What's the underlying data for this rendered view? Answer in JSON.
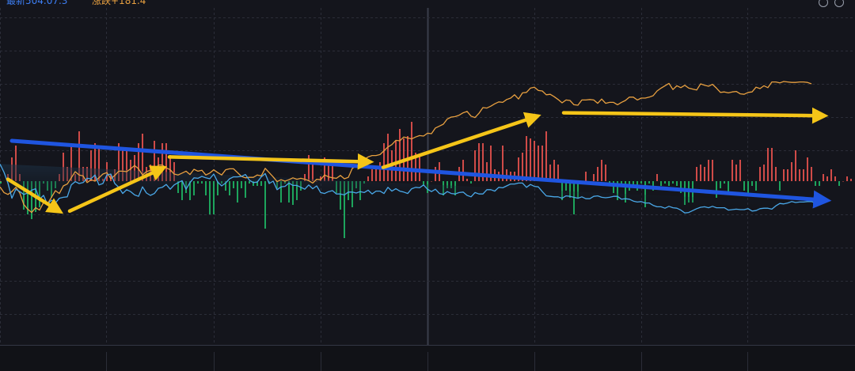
{
  "header": {
    "legend_a": "最新504.07.3",
    "legend_b": "涨跌+181.4",
    "color_a": "#3d7ff5",
    "color_b": "#e8a040",
    "tools": [
      "refresh-icon",
      "settings-icon"
    ]
  },
  "chart_data": {
    "type": "line",
    "grid": true,
    "x": [
      0,
      5,
      10,
      15,
      20,
      25,
      30,
      35,
      40,
      45,
      50,
      55,
      60,
      65,
      70,
      75,
      80,
      85,
      90,
      95,
      100,
      105,
      110,
      115,
      120,
      125,
      130,
      135,
      140,
      145,
      150,
      155,
      160,
      165,
      170,
      175,
      180,
      185,
      190,
      195,
      200,
      205,
      210,
      215,
      220,
      225,
      230,
      235,
      240,
      245,
      250,
      255,
      260,
      265,
      270,
      275,
      280,
      285,
      290,
      295,
      300,
      305,
      310,
      315,
      320,
      325,
      330,
      335,
      340,
      345,
      350,
      355,
      360,
      365,
      370,
      375,
      380,
      385,
      390,
      395,
      400,
      405,
      410,
      415,
      420,
      425,
      430,
      435,
      440,
      445,
      450,
      455,
      460,
      465,
      470,
      475,
      480,
      485,
      490,
      495,
      500,
      505,
      510,
      515,
      520,
      525,
      530,
      535,
      540,
      545,
      550,
      555,
      560,
      565,
      570,
      575,
      580,
      585,
      590,
      595,
      600,
      605,
      610,
      615,
      620,
      625,
      630,
      635,
      640,
      645,
      650,
      655,
      660,
      665,
      670,
      675,
      680,
      685,
      690,
      695,
      700,
      705,
      710,
      715,
      720,
      725,
      730,
      735,
      740,
      745,
      750,
      755,
      760,
      765,
      770,
      775,
      780,
      785,
      790,
      795,
      800,
      805,
      810,
      815,
      820,
      825,
      830,
      835,
      840,
      845,
      850,
      855,
      860,
      865,
      870,
      875,
      880,
      885,
      890,
      895,
      900,
      905,
      910,
      915,
      920,
      925,
      930,
      935,
      940,
      945,
      950,
      955,
      960,
      965,
      970,
      975,
      980,
      985,
      990,
      995,
      1000,
      1005,
      1010,
      1015,
      1020,
      1025,
      1030,
      1035,
      1040,
      1045,
      1050,
      1055,
      1060,
      1065,
      1070,
      1075
    ],
    "series": [
      {
        "color": "#e8a040",
        "values": [
          -1.2,
          -2.4,
          -2.8,
          -2.2,
          -1.3,
          -2.5,
          -4.9,
          -5.9,
          -6.6,
          -5.6,
          -6.1,
          -4.5,
          -4.8,
          -3.4,
          -2.0,
          -2.6,
          -1.0,
          -0.6,
          0.7,
          2.0,
          1.3,
          1.1,
          -0.3,
          0.3,
          -0.0,
          0.7,
          1.5,
          1.8,
          0.5,
          1.2,
          2.1,
          2.1,
          2.0,
          2.6,
          3.3,
          2.6,
          1.3,
          2.0,
          2.3,
          2.0,
          3.4,
          3.4,
          2.8,
          2.4,
          1.5,
          1.3,
          1.7,
          2.1,
          1.4,
          2.5,
          2.1,
          2.3,
          1.3,
          1.7,
          2.4,
          1.8,
          1.3,
          2.4,
          2.6,
          2.6,
          1.8,
          1.0,
          0.7,
          0.8,
          0.8,
          1.3,
          1.1,
          2.7,
          1.8,
          0.9,
          -0.1,
          0.3,
          -0.0,
          0.3,
          0.7,
          0.4,
          0.6,
          0.4,
          0.1,
          -0.4,
          0.4,
          0.3,
          1.3,
          0.9,
          0.7,
          0.6,
          1.2,
          0.5,
          0.8,
          2.7,
          3.2,
          3.4,
          4.6,
          5.1,
          5.4,
          5.4,
          5.6,
          6.4,
          7.2,
          7.7,
          8.6,
          8.5,
          9.3,
          9.1,
          8.9,
          9.3,
          9.6,
          9.5,
          10.1,
          10.0,
          11.2,
          11.6,
          12.0,
          13.1,
          13.5,
          13.6,
          13.9,
          14.4,
          14.7,
          13.7,
          13.4,
          14.3,
          15.5,
          15.4,
          15.8,
          16.3,
          16.7,
          16.6,
          17.2,
          17.5,
          18.2,
          17.3,
          18.6,
          18.7,
          19.6,
          19.8,
          19.1,
          19.0,
          18.2,
          18.3,
          17.8,
          17.2,
          16.5,
          17.1,
          17.0,
          16.1,
          16.0,
          17.1,
          17.1,
          17.2,
          17.1,
          16.4,
          17.3,
          16.4,
          16.6,
          16.6,
          16.1,
          16.6,
          17.0,
          17.7,
          17.7,
          17.1,
          17.5,
          17.5,
          17.7,
          18.0,
          19.0,
          19.6,
          20.1,
          20.6,
          19.3,
          20.1,
          19.7,
          20.2,
          19.6,
          19.4,
          19.2,
          20.5,
          20.2,
          20.0,
          20.4,
          19.6,
          18.7,
          18.8,
          18.6,
          18.8,
          18.9,
          18.4,
          18.3,
          18.7,
          18.8,
          19.8,
          19.5,
          20.1,
          19.7,
          20.9,
          20.9,
          20.7,
          21.0,
          20.9,
          20.8,
          20.8,
          20.9,
          20.9,
          20.8,
          20.5
        ]
      },
      {
        "color": "#4aa8e8",
        "values": [
          3.6,
          1.9,
          -0.4,
          -3.6,
          -1.7,
          -2.2,
          -2.8,
          -2.5,
          -1.9,
          -1.6,
          -3.8,
          -3.0,
          -4.9,
          -4.0,
          -4.6,
          -3.6,
          -3.4,
          -3.3,
          -0.8,
          -0.1,
          -0.5,
          -0.3,
          0.6,
          0.5,
          1.3,
          -0.8,
          -0.5,
          1.3,
          1.5,
          -0.5,
          -1.3,
          -2.6,
          -1.8,
          -2.2,
          -2.9,
          -3.2,
          -1.2,
          -2.5,
          -3.0,
          -2.6,
          -1.5,
          -1.3,
          -0.7,
          -1.7,
          -0.8,
          -0.3,
          0.1,
          -1.7,
          -0.3,
          0.7,
          0.6,
          1.0,
          0.7,
          0.5,
          1.5,
          -0.2,
          -1.0,
          -0.4,
          0.5,
          0.9,
          0.9,
          1.0,
          1.4,
          0.2,
          -0.3,
          -0.2,
          0.9,
          1.6,
          -0.5,
          0.0,
          -1.8,
          -1.2,
          -1.1,
          -0.4,
          -0.9,
          -0.9,
          -1.3,
          -1.7,
          -0.8,
          -1.6,
          -1.0,
          -2.4,
          -2.6,
          -2.2,
          -2.0,
          -2.7,
          -2.7,
          -2.9,
          -2.3,
          -2.3,
          -2.5,
          -2.2,
          -2.4,
          -1.9,
          -2.7,
          -2.1,
          -2.1,
          -2.6,
          -1.3,
          -2.1,
          -1.6,
          -2.1,
          -2.3,
          -2.6,
          -1.6,
          -1.3,
          -1.4,
          -0.8,
          -1.7,
          -2.2,
          -1.7,
          -2.6,
          -2.8,
          -2.2,
          -2.6,
          -2.7,
          -2.4,
          -2.3,
          -3.0,
          -3.3,
          -2.4,
          -2.7,
          -2.7,
          -1.8,
          -1.8,
          -2.1,
          -1.3,
          -1.4,
          -1.0,
          -0.6,
          -0.6,
          -0.4,
          -0.4,
          -1.3,
          -0.7,
          -1.1,
          -1.2,
          -2.2,
          -3.1,
          -3.2,
          -3.3,
          -3.3,
          -3.6,
          -3.1,
          -3.2,
          -3.4,
          -3.6,
          -3.3,
          -3.7,
          -3.7,
          -3.2,
          -3.1,
          -3.4,
          -3.5,
          -3.4,
          -3.2,
          -3.2,
          -3.8,
          -3.7,
          -3.8,
          -4.2,
          -4.4,
          -4.3,
          -4.6,
          -4.6,
          -5.1,
          -5.4,
          -5.4,
          -5.7,
          -5.3,
          -5.6,
          -5.7,
          -6.1,
          -6.7,
          -6.6,
          -6.2,
          -5.8,
          -5.5,
          -5.4,
          -5.6,
          -5.3,
          -5.6,
          -5.6,
          -5.6,
          -6.1,
          -6.0,
          -5.9,
          -6.0,
          -6.0,
          -5.8,
          -6.3,
          -6.2,
          -5.8,
          -5.7,
          -5.7,
          -5.9,
          -5.2,
          -4.7,
          -4.8,
          -4.6,
          -4.3,
          -4.5,
          -4.4,
          -4.4,
          -4.3,
          -4.3,
          -4.6
        ]
      }
    ],
    "histogram": {
      "x": [
        10,
        15,
        20,
        25,
        30,
        35,
        40,
        45,
        50,
        55,
        60,
        65,
        70,
        75,
        80,
        85,
        90,
        95,
        100,
        105,
        110,
        115,
        120,
        125,
        130,
        135,
        140,
        145,
        150,
        155,
        160,
        165,
        170,
        175,
        180,
        185,
        190,
        195,
        200,
        205,
        210,
        215,
        220,
        225,
        230,
        235,
        240,
        245,
        250,
        255,
        260,
        265,
        270,
        275,
        280,
        285,
        290,
        295,
        300,
        305,
        310,
        315,
        320,
        325,
        330,
        335,
        340,
        345,
        350,
        355,
        360,
        365,
        370,
        375,
        380,
        385,
        390,
        395,
        400,
        405,
        410,
        415,
        420,
        425,
        430,
        435,
        440,
        445,
        450,
        455,
        460,
        465,
        470,
        475,
        480,
        485,
        490,
        495,
        500,
        505,
        510,
        515,
        520,
        525,
        530,
        535,
        540,
        545,
        550,
        555,
        560,
        565,
        570,
        575,
        580,
        585,
        590,
        595,
        600,
        605,
        610,
        615,
        620,
        625,
        630,
        635,
        640,
        645,
        650,
        655,
        660,
        665,
        670,
        675,
        680,
        685,
        690,
        695,
        700,
        705,
        710,
        715,
        720,
        725,
        730,
        735,
        740,
        745,
        750,
        755,
        760,
        765,
        770,
        775,
        780,
        785,
        790,
        795,
        800,
        805,
        810,
        815,
        820,
        825,
        830,
        835,
        840,
        845,
        850,
        855,
        860,
        865,
        870,
        875,
        880,
        885,
        890,
        895,
        900,
        905,
        910,
        915,
        920,
        925,
        930,
        935,
        940,
        945,
        950,
        955,
        960,
        965,
        970,
        975,
        980,
        985,
        990,
        995,
        1000,
        1005,
        1010,
        1015,
        1020,
        1025,
        1030,
        1035,
        1040,
        1045,
        1050,
        1055,
        1060,
        1065,
        1070,
        1075
      ],
      "values": [
        0.3,
        1.0,
        1.5,
        0.3,
        -1.2,
        -1.4,
        -1.6,
        -1.3,
        -1.1,
        -0.1,
        -0.4,
        -0.7,
        -0.3,
        0.3,
        1.2,
        0.6,
        1.6,
        0.3,
        2.1,
        0.6,
        0.6,
        1.3,
        1.6,
        1.4,
        0.1,
        0.8,
        0.3,
        0.5,
        1.6,
        1.3,
        1.3,
        0.9,
        1.1,
        1.6,
        2.0,
        0.6,
        0.7,
        1.7,
        1.0,
        1.6,
        1.6,
        1.1,
        0.8,
        -0.5,
        -0.8,
        -0.5,
        -0.8,
        -0.6,
        -0.1,
        -0.1,
        -0.6,
        -1.4,
        -1.4,
        -0.6,
        -0.1,
        -0.4,
        -0.6,
        -0.3,
        -0.9,
        -0.3,
        -0.7,
        -0.1,
        -0.2,
        -0.2,
        -0.2,
        -2.0,
        -0.1,
        -0.0,
        -0.3,
        -0.9,
        -0.1,
        -0.9,
        -1.0,
        -0.8,
        -0.4,
        0.3,
        1.1,
        0.7,
        0.0,
        0.2,
        1.0,
        0.7,
        0.7,
        -0.5,
        -1.2,
        -2.4,
        -0.8,
        -1.1,
        -0.3,
        -0.8,
        -0.1,
        0.2,
        0.5,
        0.6,
        0.8,
        1.6,
        2.0,
        1.3,
        1.7,
        2.2,
        1.8,
        1.9,
        2.5,
        1.2,
        1.1,
        -0.2,
        -0.5,
        -0.0,
        0.6,
        0.8,
        -0.6,
        -0.3,
        -0.3,
        -0.6,
        0.6,
        0.9,
        0.1,
        -0.1,
        1.3,
        1.6,
        1.6,
        0.8,
        1.5,
        0.5,
        0.4,
        1.5,
        0.5,
        0.4,
        0.4,
        1.0,
        1.2,
        1.9,
        1.8,
        1.7,
        1.5,
        1.5,
        2.1,
        0.7,
        0.9,
        0.7,
        -0.8,
        -0.4,
        -0.7,
        -1.4,
        -0.7,
        -0.0,
        0.4,
        -0.1,
        0.3,
        0.6,
        0.9,
        0.7,
        -0.2,
        -0.5,
        -0.8,
        -0.2,
        -0.9,
        -0.4,
        -0.2,
        -0.4,
        -0.1,
        -1.1,
        -0.1,
        -0.4,
        0.3,
        -0.2,
        -0.1,
        -0.2,
        -0.1,
        -0.2,
        -0.5,
        -1.0,
        -0.9,
        -0.9,
        0.6,
        0.7,
        0.6,
        0.9,
        0.9,
        -0.7,
        -0.3,
        -0.1,
        -0.5,
        0.9,
        0.7,
        0.9,
        -0.4,
        -0.6,
        -0.2,
        -0.4,
        0.6,
        0.7,
        1.4,
        1.4,
        0.6,
        -0.4,
        0.5,
        0.5,
        0.8,
        1.3,
        0.5,
        0.5,
        1.0,
        0.6,
        -0.2,
        -0.2,
        0.3,
        0.2,
        0.5,
        0.2,
        -0.2,
        -0.0,
        0.2,
        0.1,
        -0.1,
        -0.1,
        -0.1,
        0.0
      ],
      "colors": {
        "up": "#e5514d",
        "down": "#1fb464"
      }
    },
    "annotations": {
      "arrows": [
        {
          "name": "blue-trend-arrow",
          "color": "#1f55e0",
          "from": [
            15,
            8.5
          ],
          "to": [
            1032,
            -3.9
          ]
        },
        {
          "name": "yellow-arrow-1",
          "color": "#f5c518",
          "from": [
            10,
            0.4
          ],
          "to": [
            66,
            -5.4
          ]
        },
        {
          "name": "yellow-arrow-2",
          "color": "#f5c518",
          "from": [
            88,
            -6.3
          ],
          "to": [
            196,
            2.0
          ]
        },
        {
          "name": "yellow-arrow-3",
          "color": "#f5c518",
          "from": [
            214,
            5.1
          ],
          "to": [
            456,
            4.1
          ]
        },
        {
          "name": "yellow-arrow-4",
          "color": "#f5c518",
          "from": [
            484,
            2.9
          ],
          "to": [
            668,
            13.1
          ]
        },
        {
          "name": "yellow-arrow-5",
          "color": "#f5c518",
          "from": [
            712,
            14.4
          ],
          "to": [
            1030,
            13.8
          ]
        }
      ]
    }
  }
}
